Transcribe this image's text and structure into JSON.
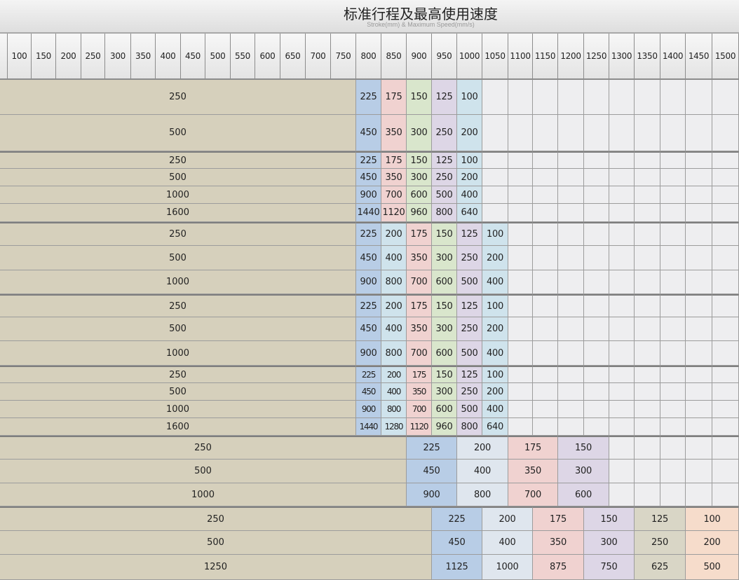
{
  "title": "标准行程及最高使用速度",
  "subtitle": "Stroke(mm) & Maximum Speed(mm/s)",
  "strokes": [
    "100",
    "150",
    "200",
    "250",
    "300",
    "350",
    "400",
    "450",
    "500",
    "550",
    "600",
    "650",
    "700",
    "750",
    "800",
    "850",
    "900",
    "950",
    "1000",
    "1050",
    "1100",
    "1150",
    "1200",
    "1250",
    "1300",
    "1350",
    "1400",
    "1450",
    "1500"
  ],
  "colors": {
    "base_fill": "#d6d0bc",
    "empty_fill": "#eeeef0",
    "blue": "#b8cde6",
    "pink": "#f0d2d0",
    "green": "#d9e6cc",
    "lavender": "#ddd6e6",
    "cyan": "#cfe3ec",
    "peach": "#f6dccb",
    "khaki": "#d9d6c6",
    "light_blue": "#dfe6ee"
  },
  "groups": [
    {
      "rows": [
        {
          "lead": "250",
          "speeds": [
            "225",
            "175",
            "150",
            "125",
            "100"
          ]
        },
        {
          "lead": "500",
          "speeds": [
            "450",
            "350",
            "300",
            "250",
            "200"
          ]
        }
      ]
    },
    {
      "rows": [
        {
          "lead": "250",
          "speeds": [
            "225",
            "175",
            "150",
            "125",
            "100"
          ]
        },
        {
          "lead": "500",
          "speeds": [
            "450",
            "350",
            "300",
            "250",
            "200"
          ]
        },
        {
          "lead": "1000",
          "speeds": [
            "900",
            "700",
            "600",
            "500",
            "400"
          ]
        },
        {
          "lead": "1600",
          "speeds": [
            "1440",
            "1120",
            "960",
            "800",
            "640"
          ]
        }
      ]
    },
    {
      "rows": [
        {
          "lead": "250",
          "speeds": [
            "225",
            "200",
            "175",
            "150",
            "125",
            "100"
          ]
        },
        {
          "lead": "500",
          "speeds": [
            "450",
            "400",
            "350",
            "300",
            "250",
            "200"
          ]
        },
        {
          "lead": "1000",
          "speeds": [
            "900",
            "800",
            "700",
            "600",
            "500",
            "400"
          ]
        }
      ]
    },
    {
      "rows": [
        {
          "lead": "250",
          "speeds": [
            "225",
            "200",
            "175",
            "150",
            "125",
            "100"
          ]
        },
        {
          "lead": "500",
          "speeds": [
            "450",
            "400",
            "350",
            "300",
            "250",
            "200"
          ]
        },
        {
          "lead": "1000",
          "speeds": [
            "900",
            "800",
            "700",
            "600",
            "500",
            "400"
          ]
        }
      ]
    },
    {
      "rows": [
        {
          "lead": "250",
          "speeds": [
            "225",
            "200",
            "175",
            "150",
            "125",
            "100"
          ]
        },
        {
          "lead": "500",
          "speeds": [
            "450",
            "400",
            "350",
            "300",
            "250",
            "200"
          ]
        },
        {
          "lead": "1000",
          "speeds": [
            "900",
            "800",
            "700",
            "600",
            "500",
            "400"
          ]
        },
        {
          "lead": "1600",
          "speeds": [
            "1440",
            "1280",
            "1120",
            "960",
            "800",
            "640"
          ]
        }
      ]
    },
    {
      "rows": [
        {
          "lead": "250",
          "speeds": [
            "225",
            "200",
            "175",
            "150"
          ]
        },
        {
          "lead": "500",
          "speeds": [
            "450",
            "400",
            "350",
            "300"
          ]
        },
        {
          "lead": "1000",
          "speeds": [
            "900",
            "800",
            "700",
            "600"
          ]
        }
      ]
    },
    {
      "rows": [
        {
          "lead": "250",
          "speeds": [
            "225",
            "200",
            "175",
            "150",
            "125",
            "100"
          ]
        },
        {
          "lead": "500",
          "speeds": [
            "450",
            "400",
            "350",
            "300",
            "250",
            "200"
          ]
        },
        {
          "lead": "1250",
          "speeds": [
            "1125",
            "1000",
            "875",
            "750",
            "625",
            "500"
          ]
        }
      ]
    }
  ]
}
